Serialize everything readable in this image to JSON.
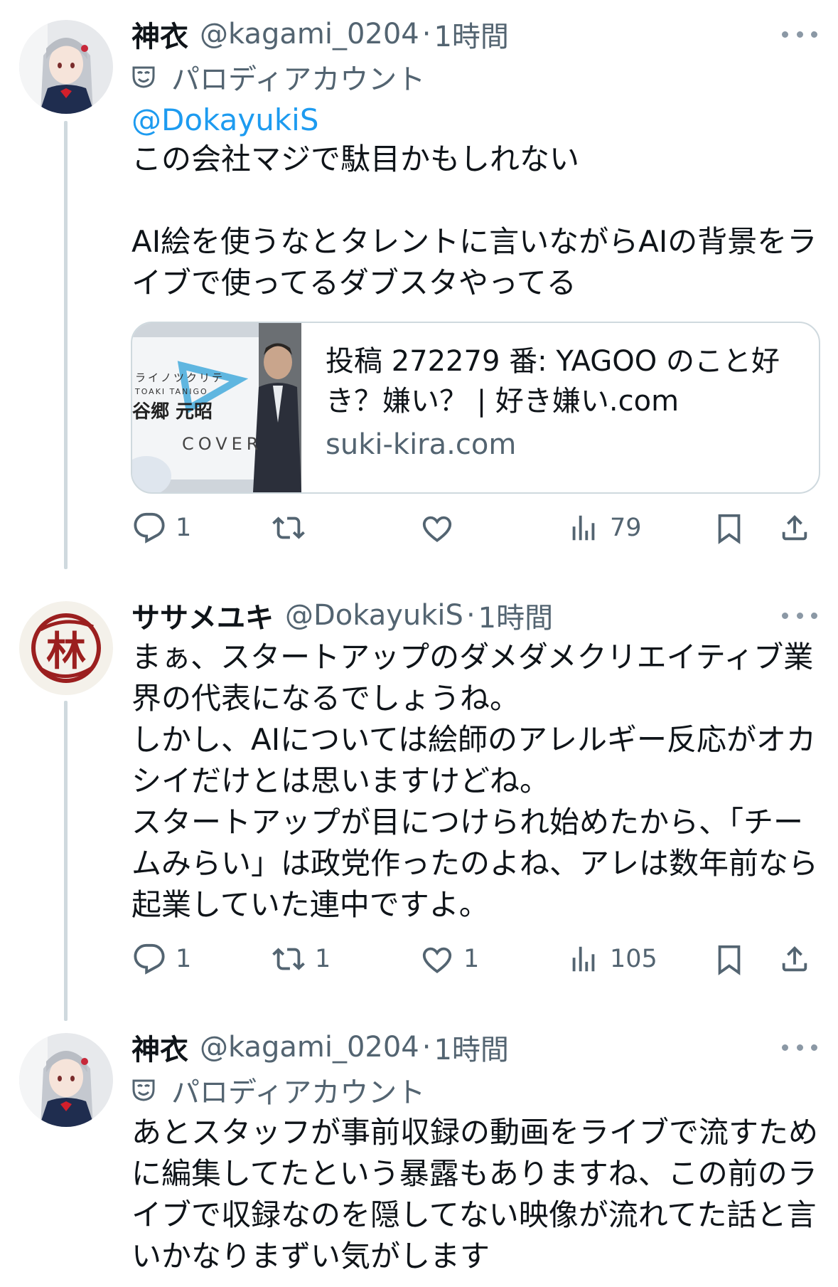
{
  "posts": [
    {
      "name": "神衣",
      "handle": "@kagami_0204",
      "separator": "·",
      "time": "1時間",
      "parody_label": "パロディアカウント",
      "mention": "@DokayukiS",
      "text": "この会社マジで駄目かもしれない\n\nAI絵を使うなとタレントに言いながらAIの背景をライブで使ってるダブスタやってる",
      "link_card": {
        "title": "投稿 272279 番: YAGOO のこと好き？嫌い？ | 好き嫌い.com",
        "domain": "suki-kira.com",
        "image_text": {
          "line1": "ライノツクリテ",
          "line2": "TOAKI TANIGO",
          "line3": "谷郷 元昭",
          "logo": "COVER"
        }
      },
      "actions": {
        "reply": "1",
        "repost": "",
        "like": "",
        "views": "79"
      }
    },
    {
      "name": "ササメユキ",
      "handle": "@DokayukiS",
      "separator": "·",
      "time": "1時間",
      "avatar_glyph": "林",
      "text": "まぁ、スタートアップのダメダメクリエイティブ業界の代表になるでしょうね。\nしかし、AIについては絵師のアレルギー反応がオカシイだけとは思いますけどね。\nスタートアップが目につけられ始めたから、「チームみらい」は政党作ったのよね、アレは数年前なら起業していた連中ですよ。",
      "actions": {
        "reply": "1",
        "repost": "1",
        "like": "1",
        "views": "105"
      }
    },
    {
      "name": "神衣",
      "handle": "@kagami_0204",
      "separator": "·",
      "time": "1時間",
      "parody_label": "パロディアカウント",
      "text": "あとスタッフが事前収録の動画をライブで流すために編集してたという暴露もありますね、この前のライブで収録なのを隠してない映像が流れてた話と言いかなりまずい気がします"
    }
  ],
  "colors": {
    "text": "#0f1419",
    "secondary": "#536471",
    "link": "#1d9bf0",
    "border": "#cfd9de",
    "thread_line": "#cfd9de"
  },
  "icons": [
    "more-icon",
    "parody-mask-icon",
    "reply-icon",
    "repost-icon",
    "like-icon",
    "views-icon",
    "bookmark-icon",
    "share-icon"
  ]
}
